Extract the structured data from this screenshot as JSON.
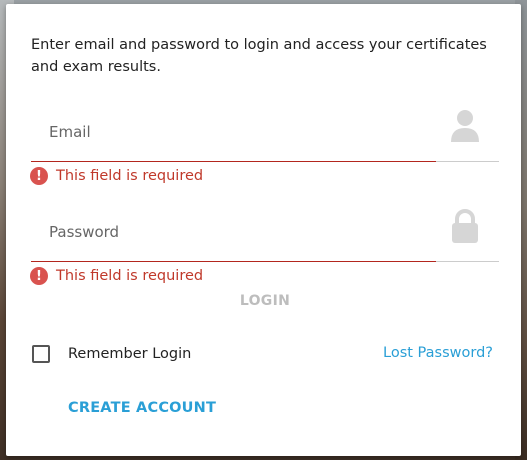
{
  "login_form": {
    "intro_text": "Enter email and password to login and access your certificates and exam results.",
    "email": {
      "placeholder": "Email",
      "value": "",
      "error": "This field is required",
      "icon": "user-icon"
    },
    "password": {
      "placeholder": "Password",
      "value": "",
      "error": "This field is required",
      "icon": "lock-icon"
    },
    "login_label": "LOGIN",
    "remember_label": "Remember Login",
    "remember_checked": false,
    "lost_password_label": "Lost Password?",
    "create_account_label": "CREATE ACCOUNT"
  },
  "colors": {
    "error": "#c0392b",
    "link": "#2a9fd6",
    "disabled": "#bdbdbd",
    "icon": "#d6d6d6"
  }
}
